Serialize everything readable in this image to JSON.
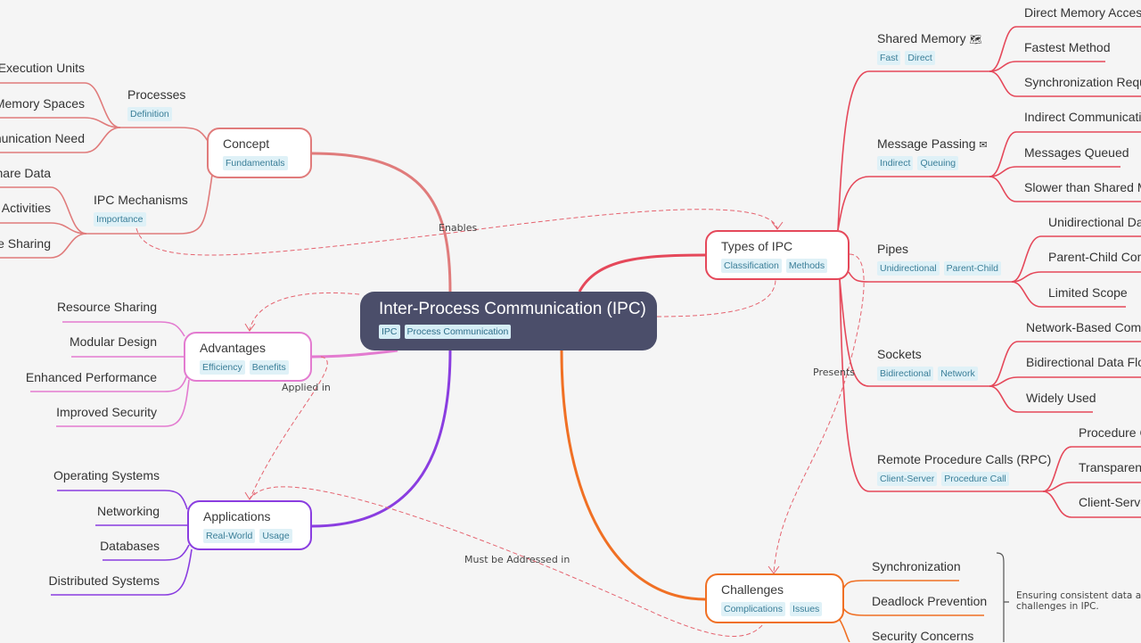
{
  "root": {
    "title": "Inter-Process Communication (IPC)",
    "tags": [
      "IPC",
      "Process Communication"
    ]
  },
  "colors": {
    "concept": "#e07b7b",
    "types": "#e5485a",
    "advantages": "#e37bd0",
    "applications": "#8a3de0",
    "challenges": "#f07024",
    "root_bg": "#4b4e6a",
    "tag_bg": "#dff1f7",
    "tag_text": "#3a7e98",
    "background": "#f5f5f5"
  },
  "concept": {
    "title": "Concept",
    "tags": [
      "Fundamentals"
    ],
    "processes": {
      "title": "Processes",
      "tags": [
        "Definition"
      ],
      "leaves": [
        "Execution Units",
        "Memory Spaces",
        "nunication Need"
      ]
    },
    "mechanisms": {
      "title": "IPC Mechanisms",
      "tags": [
        "Importance"
      ],
      "leaves": [
        "hare Data",
        "Activities",
        "ce Sharing"
      ]
    }
  },
  "types": {
    "title": "Types of IPC",
    "tags": [
      "Classification",
      "Methods"
    ],
    "shared_memory": {
      "title": "Shared Memory",
      "icon": "map-icon",
      "tags": [
        "Fast",
        "Direct"
      ],
      "leaves": [
        "Direct Memory Access",
        "Fastest Method",
        "Synchronization Requ"
      ]
    },
    "message_passing": {
      "title": "Message Passing",
      "icon": "envelope-icon",
      "tags": [
        "Indirect",
        "Queuing"
      ],
      "leaves": [
        "Indirect Communicati",
        "Messages Queued",
        "Slower than Shared M"
      ]
    },
    "pipes": {
      "title": "Pipes",
      "tags": [
        "Unidirectional",
        "Parent-Child"
      ],
      "leaves": [
        "Unidirectional Da",
        "Parent-Child Com",
        "Limited Scope"
      ]
    },
    "sockets": {
      "title": "Sockets",
      "tags": [
        "Bidirectional",
        "Network"
      ],
      "leaves": [
        "Network-Based Comm",
        "Bidirectional Data Flo",
        "Widely Used"
      ]
    },
    "rpc": {
      "title": "Remote Procedure Calls (RPC)",
      "tags": [
        "Client-Server",
        "Procedure Call"
      ],
      "leaves": [
        "Procedure C",
        "Transparenc",
        "Client-Serve"
      ]
    }
  },
  "advantages": {
    "title": "Advantages",
    "tags": [
      "Efficiency",
      "Benefits"
    ],
    "leaves": [
      "Resource Sharing",
      "Modular Design",
      "Enhanced Performance",
      "Improved Security"
    ]
  },
  "applications": {
    "title": "Applications",
    "tags": [
      "Real-World",
      "Usage"
    ],
    "leaves": [
      "Operating Systems",
      "Networking",
      "Databases",
      "Distributed Systems"
    ]
  },
  "challenges": {
    "title": "Challenges",
    "tags": [
      "Complications",
      "Issues"
    ],
    "leaves": [
      "Synchronization",
      "Deadlock Prevention",
      "Security Concerns"
    ],
    "summary": [
      "Ensuring consistent data ac",
      "challenges in IPC."
    ]
  },
  "relations": {
    "enables": "Enables",
    "applied_in": "Applied in",
    "presents": "Presents",
    "must_be_addressed": "Must be Addressed in"
  }
}
